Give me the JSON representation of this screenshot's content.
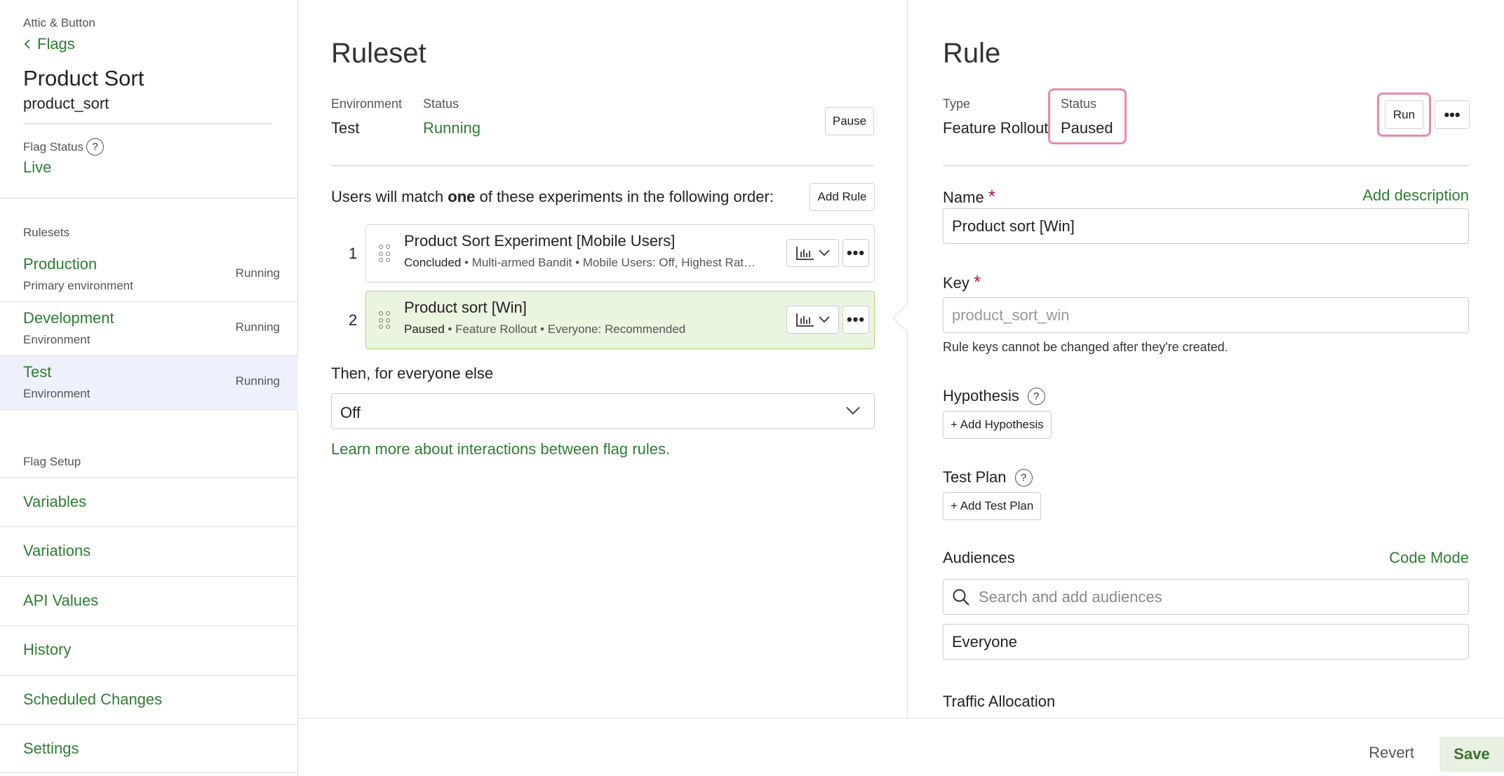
{
  "sidebar": {
    "org": "Attic & Button",
    "back_label": "Flags",
    "flag_title": "Product Sort",
    "flag_key": "product_sort",
    "flag_status_label": "Flag Status",
    "flag_status_value": "Live",
    "rulesets_label": "Rulesets",
    "rulesets": [
      {
        "name": "Production",
        "desc": "Primary environment",
        "status": "Running"
      },
      {
        "name": "Development",
        "desc": "Environment",
        "status": "Running"
      },
      {
        "name": "Test",
        "desc": "Environment",
        "status": "Running"
      }
    ],
    "flag_setup_label": "Flag Setup",
    "nav": [
      "Variables",
      "Variations",
      "API Values",
      "History",
      "Scheduled Changes",
      "Settings"
    ]
  },
  "ruleset": {
    "title": "Ruleset",
    "env_label": "Environment",
    "env_value": "Test",
    "status_label": "Status",
    "status_value": "Running",
    "pause_label": "Pause",
    "order_prefix": "Users will match ",
    "order_bold": "one",
    "order_suffix": " of these experiments in the following order:",
    "add_rule_label": "Add Rule",
    "rules": [
      {
        "num": "1",
        "title": "Product Sort Experiment [Mobile Users]",
        "state": "Concluded",
        "details": " • Multi-armed Bandit • Mobile Users: Off, Highest Rat…"
      },
      {
        "num": "2",
        "title": "Product sort [Win]",
        "state": "Paused",
        "details": " • Feature Rollout • Everyone: Recommended"
      }
    ],
    "then_text": "Then, for everyone else",
    "fallback_value": "Off",
    "learn_more": "Learn more about interactions between flag rules."
  },
  "rule": {
    "title": "Rule",
    "type_label": "Type",
    "type_value": "Feature Rollout",
    "status_label": "Status",
    "status_value": "Paused",
    "run_label": "Run",
    "name_label": "Name",
    "add_description": "Add description",
    "name_value": "Product sort [Win]",
    "key_label": "Key",
    "key_placeholder": "product_sort_win",
    "key_hint": "Rule keys cannot be changed after they're created.",
    "hypothesis_label": "Hypothesis",
    "add_hypothesis": "+ Add Hypothesis",
    "test_plan_label": "Test Plan",
    "add_test_plan": "+ Add Test Plan",
    "audiences_label": "Audiences",
    "code_mode": "Code Mode",
    "audience_search_placeholder": "Search and add audiences",
    "audience_selected": "Everyone",
    "traffic_label": "Traffic Allocation",
    "required_mark": "*"
  },
  "footer": {
    "revert_label": "Revert",
    "save_label": "Save"
  },
  "colors": {
    "accent_green": "#2e7d32",
    "highlight_pink": "#e88aab",
    "selected_rule_bg": "#eaf5e0",
    "active_ruleset_bg": "#eef0fb"
  }
}
